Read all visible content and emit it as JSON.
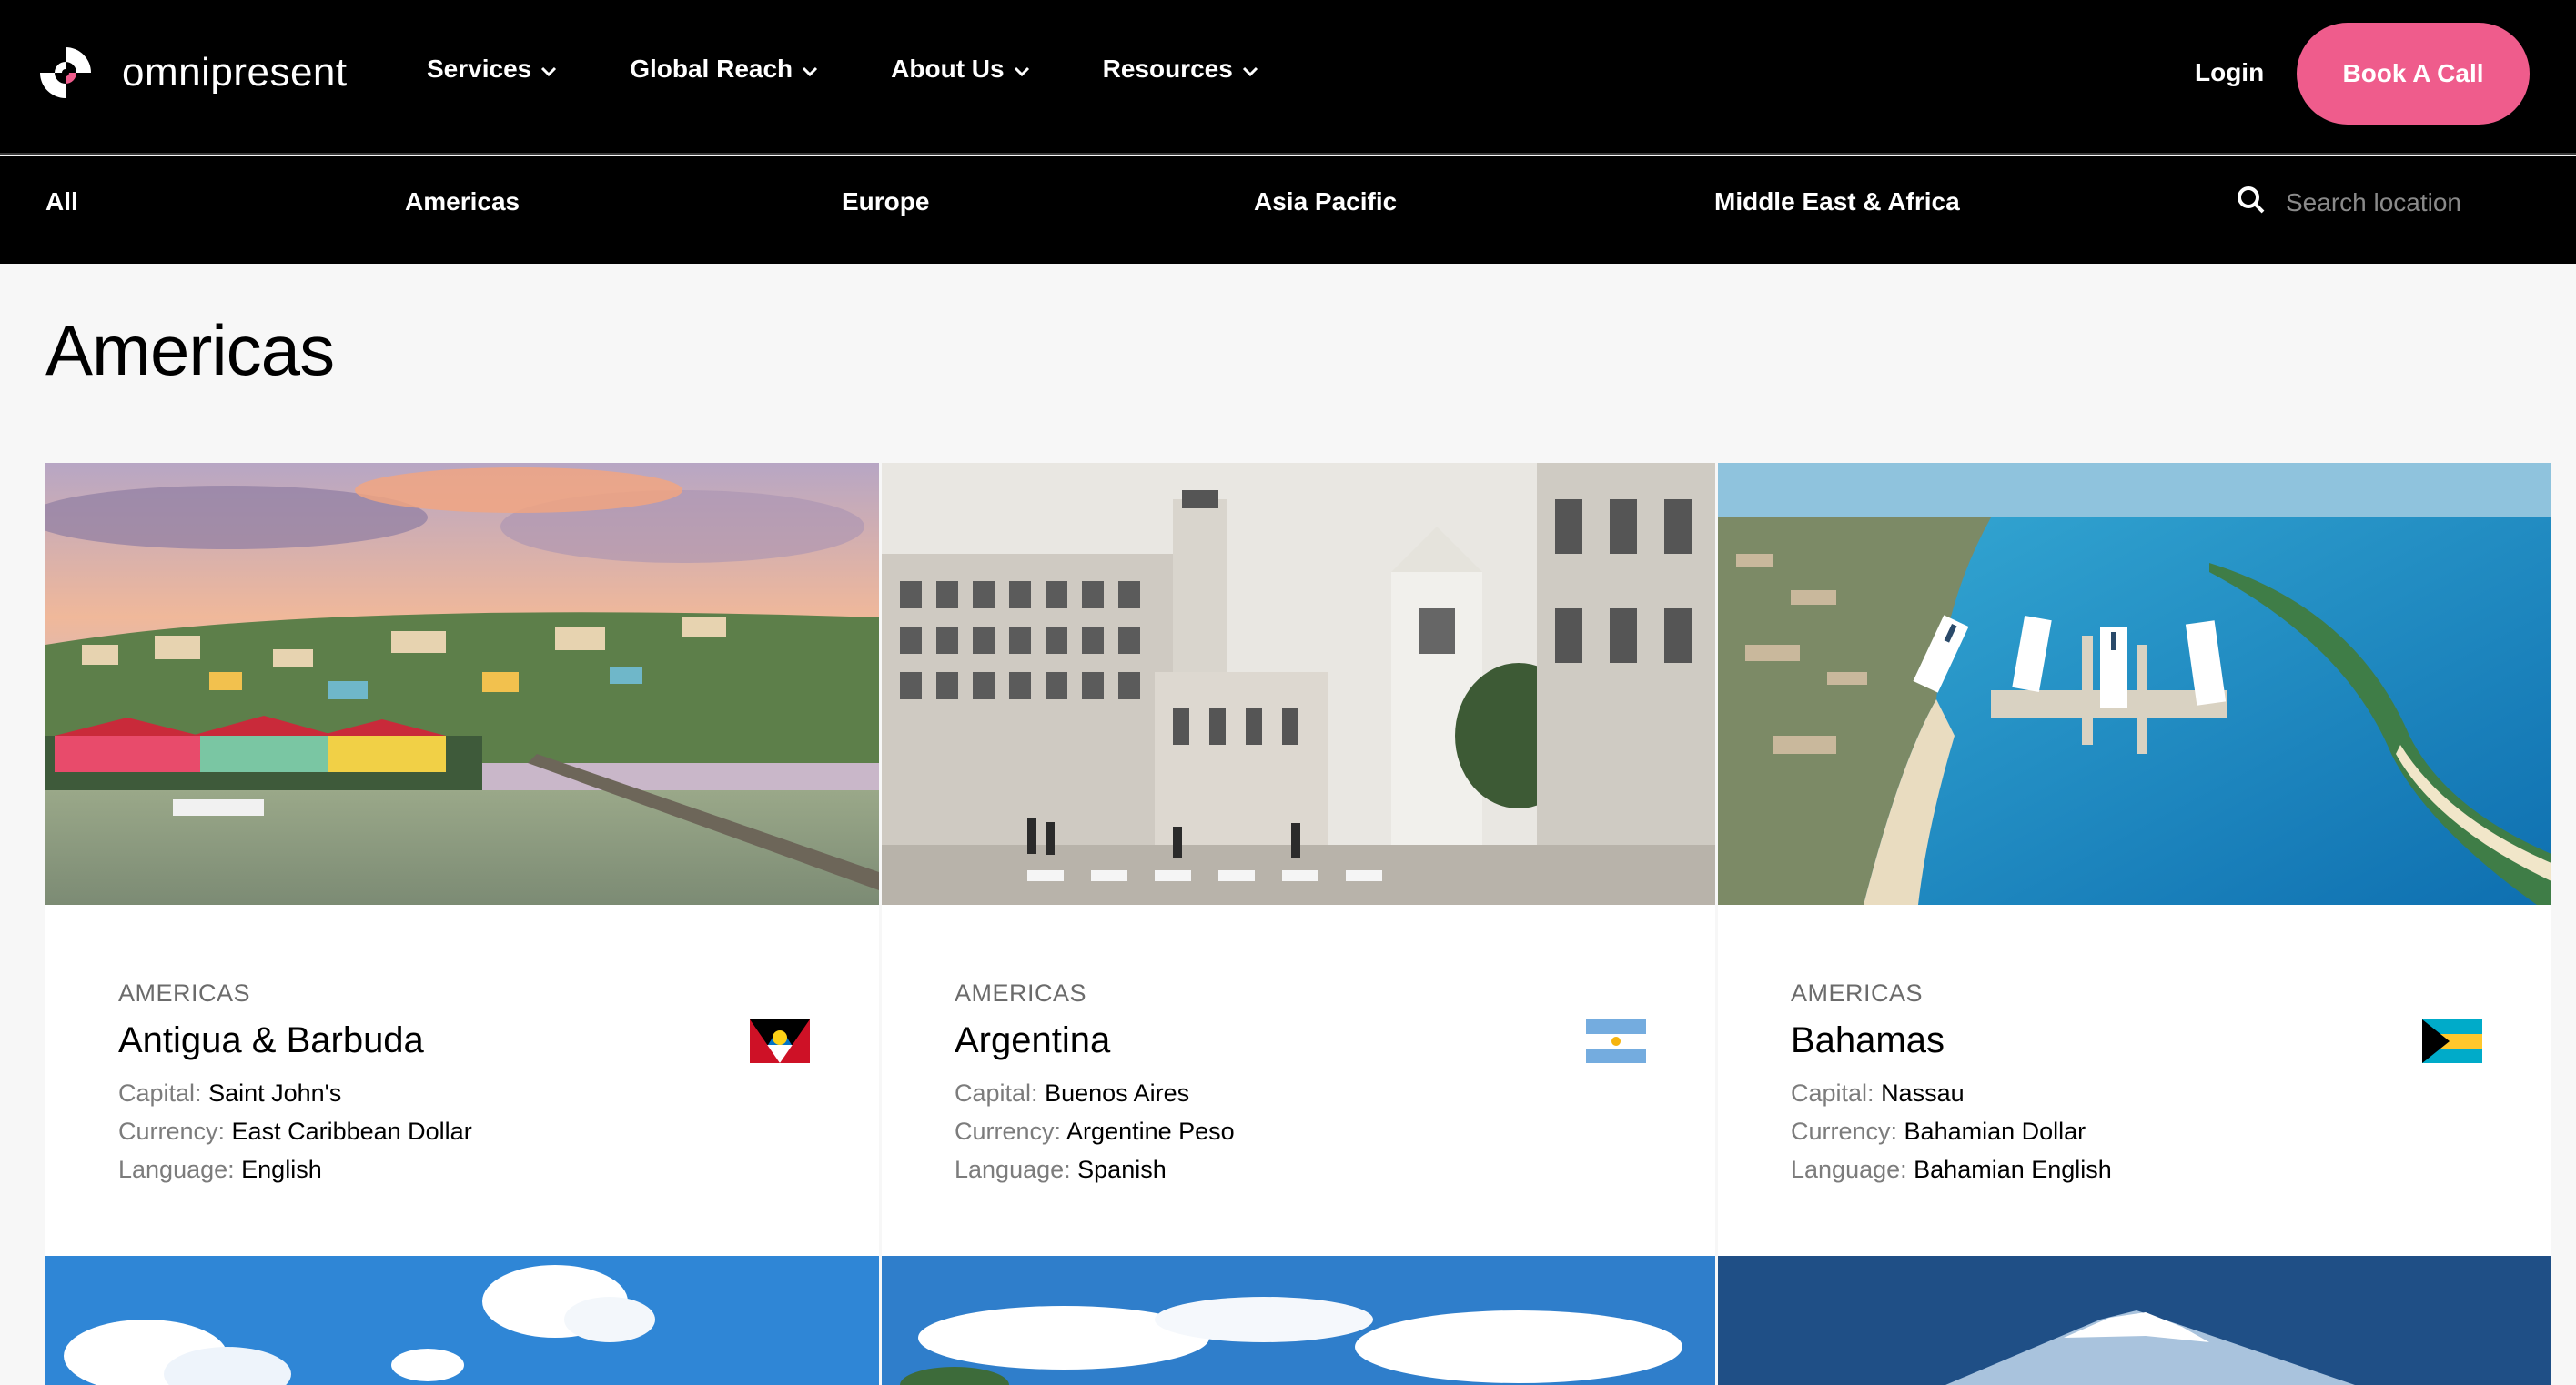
{
  "brand": {
    "name": "omnipresent",
    "accent": "#ef5c8c"
  },
  "nav": {
    "items": [
      {
        "label": "Services"
      },
      {
        "label": "Global Reach"
      },
      {
        "label": "About Us"
      },
      {
        "label": "Resources"
      }
    ],
    "login": "Login",
    "cta": "Book A Call"
  },
  "regions": {
    "tabs": [
      "All",
      "Americas",
      "Europe",
      "Asia Pacific",
      "Middle East & Africa"
    ],
    "search_placeholder": "Search location",
    "search_icon": "search-icon"
  },
  "page": {
    "title": "Americas"
  },
  "labels": {
    "capital": "Capital:",
    "currency": "Currency:",
    "language": "Language:"
  },
  "cards": [
    {
      "region": "AMERICAS",
      "country": "Antigua & Barbuda",
      "capital": "Saint John's",
      "currency": "East Caribbean Dollar",
      "language": "English",
      "flag": "antigua-flag-icon"
    },
    {
      "region": "AMERICAS",
      "country": "Argentina",
      "capital": "Buenos Aires",
      "currency": "Argentine Peso",
      "language": "Spanish",
      "flag": "argentina-flag-icon"
    },
    {
      "region": "AMERICAS",
      "country": "Bahamas",
      "capital": "Nassau",
      "currency": "Bahamian Dollar",
      "language": "Bahamian English",
      "flag": "bahamas-flag-icon"
    }
  ]
}
